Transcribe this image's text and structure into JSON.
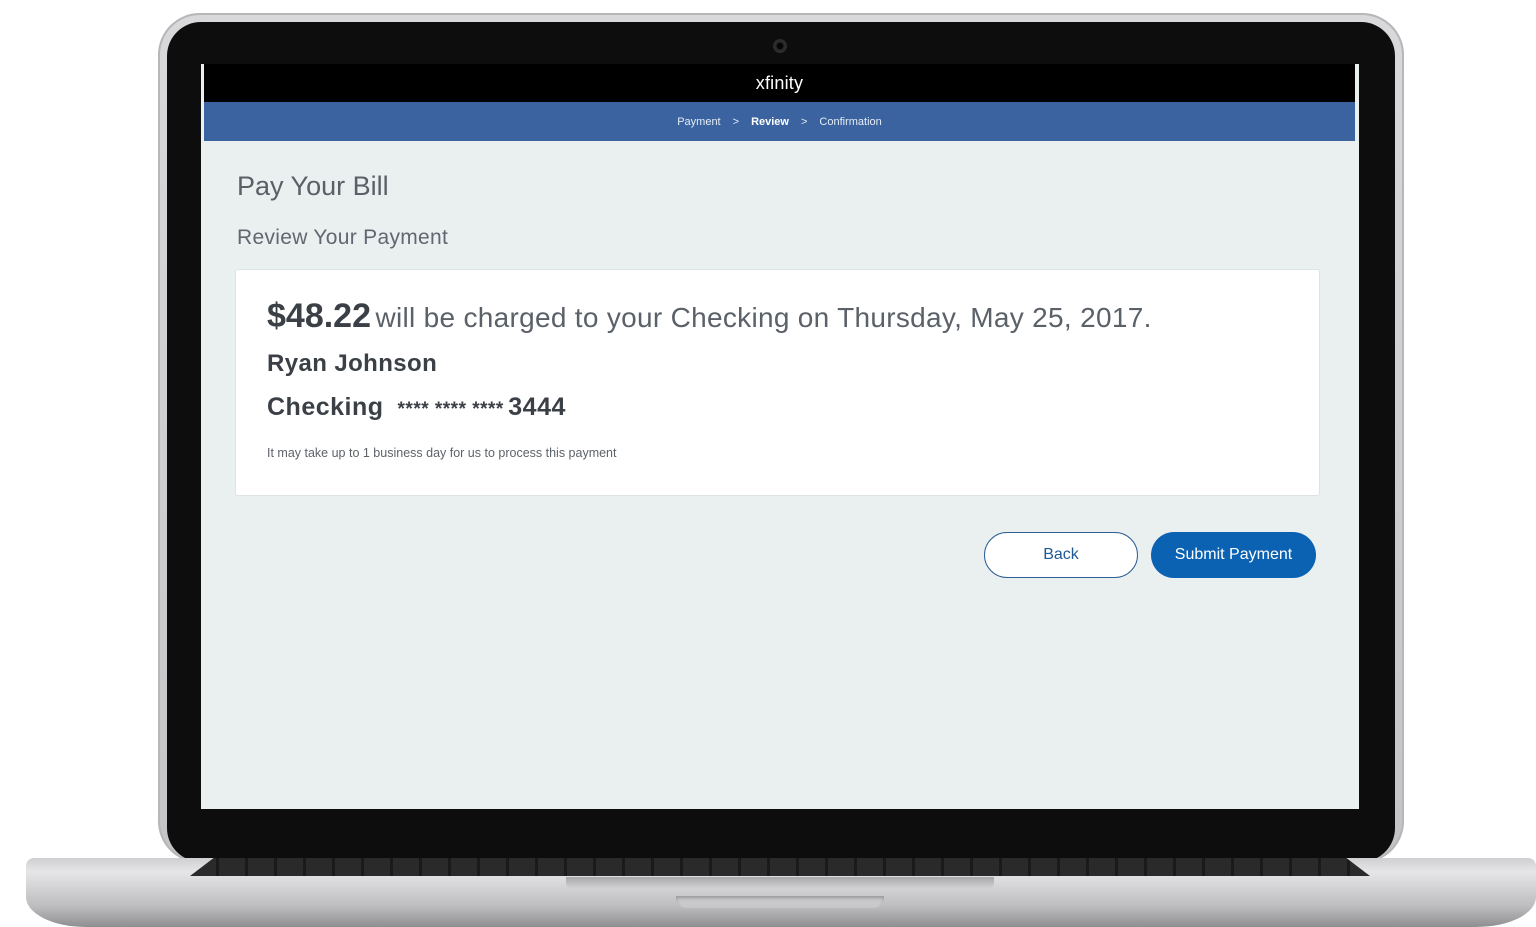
{
  "header": {
    "logo_text": "xfinity"
  },
  "steps": [
    {
      "label": "Payment",
      "active": false
    },
    {
      "label": "Review",
      "active": true
    },
    {
      "label": "Confirmation",
      "active": false
    }
  ],
  "step_separator": ">",
  "page": {
    "title": "Pay Your Bill",
    "subtitle": "Review Your Payment"
  },
  "review": {
    "amount": "$48.22",
    "summary_text": "will be charged to your Checking on Thursday, May 25, 2017.",
    "payer_name": "Ryan Johnson",
    "account_type": "Checking",
    "account_mask": "**** **** ****",
    "account_last4": "3444",
    "processing_note": "It may take up to 1 business day for us to process this payment"
  },
  "actions": {
    "back_label": "Back",
    "submit_label": "Submit Payment"
  },
  "colors": {
    "stepbar": "#3a63a0",
    "primary": "#0b62b2",
    "page_bg": "#eaeff0"
  }
}
